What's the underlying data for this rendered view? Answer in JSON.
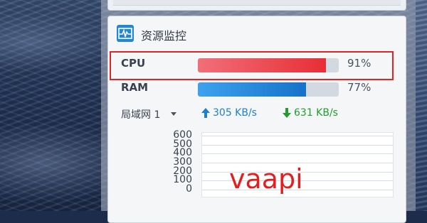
{
  "widget": {
    "title": "资源监控",
    "icon": "resource-monitor-icon"
  },
  "resources": [
    {
      "label": "CPU",
      "percent_text": "91%",
      "usage": 91,
      "color": "#e82e36"
    },
    {
      "label": "RAM",
      "percent_text": "77%",
      "usage": 77,
      "color": "#1f87d6"
    }
  ],
  "network": {
    "interface_label": "局域网 1",
    "upload": "305 KB/s",
    "download": "631 KB/s",
    "upload_color": "#1d7fd1",
    "download_color": "#1f9e2c"
  },
  "chart_data": {
    "type": "line",
    "title": "",
    "xlabel": "",
    "ylabel": "",
    "yticks": [
      "600",
      "500",
      "400",
      "300",
      "200",
      "100",
      "0"
    ],
    "ylim": [
      0,
      600
    ],
    "grid": true,
    "series": []
  },
  "overlay": {
    "watermark_text": "vaapi",
    "highlight_color": "#e02424"
  }
}
